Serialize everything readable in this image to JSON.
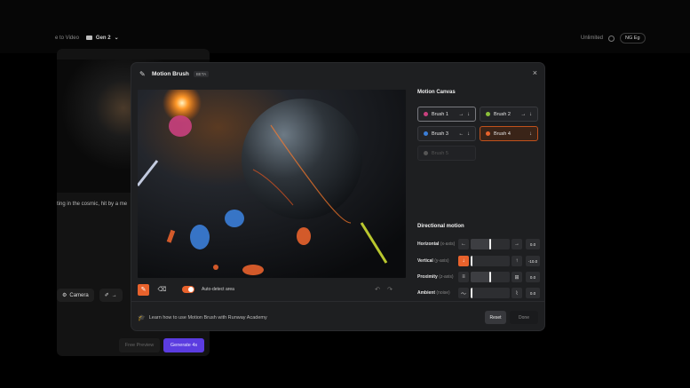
{
  "background": {
    "breadcrumb_prev": "e to Video",
    "breadcrumb_current": "Gen 2",
    "chevron": "⌄",
    "plan": "Unlimited",
    "language_pill": "NG Eg",
    "prompt_text": "ting in the cosmic, hit by a me",
    "tool_camera": "Camera",
    "tool_arrow": "→",
    "free_preview": "Free Preview",
    "generate": "Generate 4s"
  },
  "modal": {
    "title": "Motion Brush",
    "badge": "BETA",
    "close": "×",
    "auto_detect_label": "Auto-detect area",
    "academy_link": "Learn how to use Motion Brush with Runway Academy",
    "reset": "Reset",
    "done": "Done",
    "motion_canvas_title": "Motion Canvas",
    "directional_title": "Directional motion",
    "brushes": [
      {
        "label": "Brush 1",
        "color": "#c9407e",
        "arrows": "→ ↓",
        "state": "selected"
      },
      {
        "label": "Brush 2",
        "color": "#8bbf3a",
        "arrows": "→ ↓",
        "state": "normal"
      },
      {
        "label": "Brush 3",
        "color": "#3b7ed8",
        "arrows": "← ↓",
        "state": "normal"
      },
      {
        "label": "Brush 4",
        "color": "#e8622c",
        "arrows": "↓",
        "state": "active"
      },
      {
        "label": "Brush 5",
        "color": "#555555",
        "arrows": "",
        "state": "disabled"
      }
    ],
    "directional": [
      {
        "label": "Horizontal",
        "axis": "(x-axis)",
        "icon_left": "←",
        "icon_right": "→",
        "value": "0.0",
        "level": 0.5
      },
      {
        "label": "Vertical",
        "axis": "(y-axis)",
        "icon_left": "↓",
        "icon_right": "↑",
        "value": "-10.0",
        "level": 0.0
      },
      {
        "label": "Proximity",
        "axis": "(z-axis)",
        "icon_left": "≡",
        "icon_right": "⊞",
        "value": "0.0",
        "level": 0.5
      },
      {
        "label": "Ambient",
        "axis": "(noise)",
        "icon_left": "〜",
        "icon_right": "⌇",
        "value": "0.0",
        "level": 0.0
      }
    ]
  },
  "colors": {
    "accent": "#e8622c",
    "generate": "#5b3ce0",
    "modal_bg": "#1e1f21"
  }
}
